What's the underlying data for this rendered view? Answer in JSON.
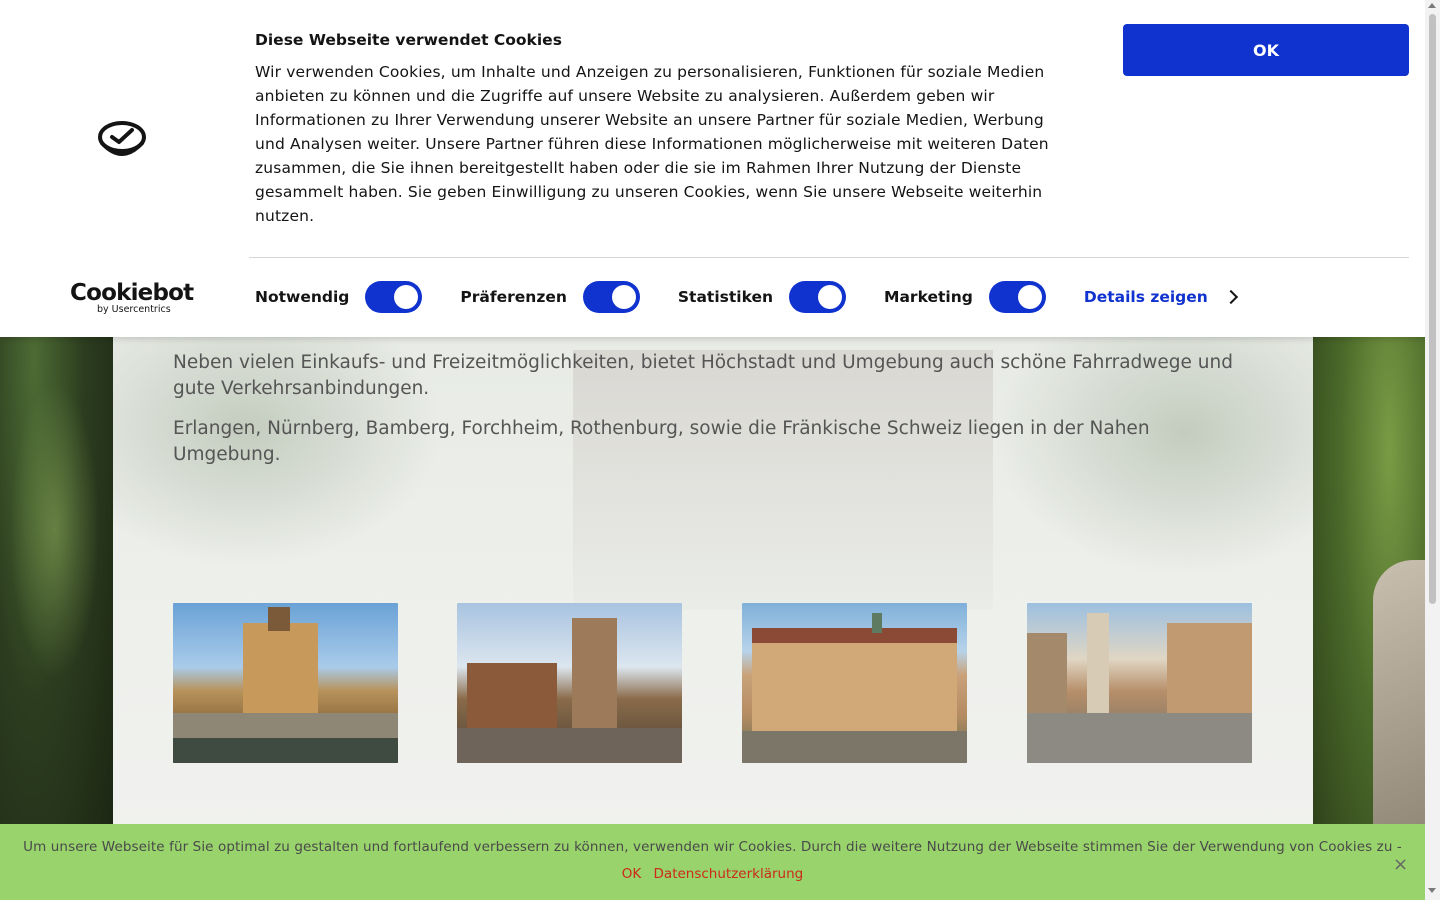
{
  "cookiebot": {
    "title": "Diese Webseite verwendet Cookies",
    "body": "Wir verwenden Cookies, um Inhalte und Anzeigen zu personalisieren, Funktionen für soziale Medien anbieten zu können und die Zugriffe auf unsere Website zu analysieren. Außerdem geben wir Informationen zu Ihrer Verwendung unserer Website an unsere Partner für soziale Medien, Werbung und Analysen weiter. Unsere Partner führen diese Informationen möglicherweise mit weiteren Daten zusammen, die Sie ihnen bereitgestellt haben oder die sie im Rahmen Ihrer Nutzung der Dienste gesammelt haben. Sie geben Einwilligung zu unseren Cookies, wenn Sie unsere Webseite weiterhin nutzen.",
    "ok_label": "OK",
    "brand_name": "Cookiebot",
    "brand_sub": "by Usercentrics",
    "toggles": [
      {
        "label": "Notwendig",
        "on": true
      },
      {
        "label": "Präferenzen",
        "on": true
      },
      {
        "label": "Statistiken",
        "on": true
      },
      {
        "label": "Marketing",
        "on": true
      }
    ],
    "details_label": "Details zeigen",
    "accent_color": "#1032cf"
  },
  "main": {
    "paragraphs": [
      "Neben vielen Einkaufs- und Freizeitmöglichkeiten, bietet Höchstadt und Umgebung auch schöne Fahrradwege und gute Verkehrsanbindungen.",
      "Erlangen, Nürnberg, Bamberg, Forchheim, Rothenburg, sowie die Fränkische Schweiz liegen in der Nahen Umgebung."
    ],
    "thumbnails": [
      "bamberg-photo",
      "nuernberg-photo",
      "erlangen-photo",
      "rothenburg-photo"
    ]
  },
  "cookie_notice": {
    "text": "Um unsere Webseite für Sie optimal zu gestalten und fortlaufend verbessern zu können, verwenden wir Cookies. Durch die weitere Nutzung der Webseite stimmen Sie der Verwendung von Cookies zu -",
    "ok_label": "OK",
    "privacy_label": "Datenschutzerklärung",
    "close_icon": "×",
    "background_color": "#98d36b",
    "link_color": "#cc2a1a"
  }
}
